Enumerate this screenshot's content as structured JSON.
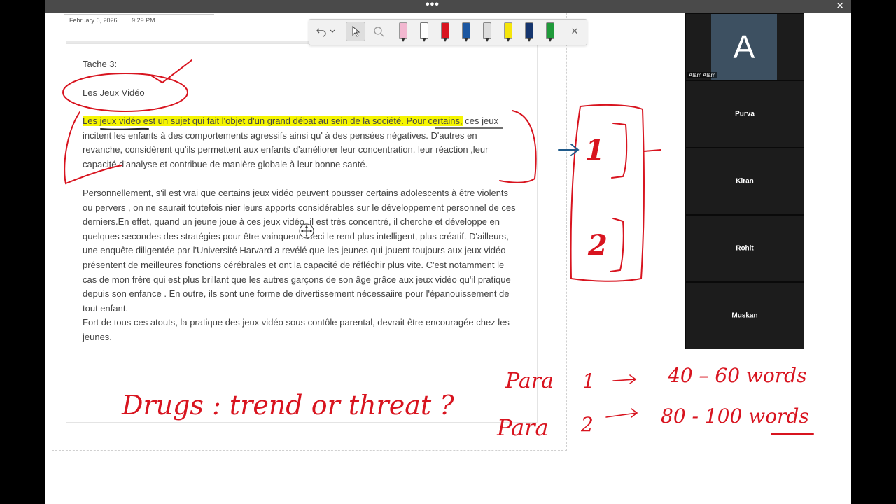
{
  "window": {
    "menu_dots": "•••",
    "close": "✕"
  },
  "note": {
    "date": "February 6, 2026",
    "time": "9:29 PM"
  },
  "toolbar": {
    "tools": [
      "undo-icon",
      "undo-dropdown-icon",
      "select-icon",
      "lasso-icon",
      "pink-highlighter-icon",
      "pen-white-icon",
      "red-pen-icon",
      "blue-pen-icon",
      "pencil-icon",
      "yellow-highlighter-icon",
      "navy-pen-icon",
      "green-pen-icon",
      "close-icon"
    ],
    "close": "✕"
  },
  "document": {
    "heading": "Tache 3:",
    "subtitle": "Les Jeux Vidéo",
    "p1_highlight_a": "Les jeux vidéo est un sujet qui fait l'objet d'un grand débat au sein de la société",
    "p1_highlight_b": ". Pour certains,",
    "p1_rest": "ces jeux  incitent les enfants à des comportements agressifs ainsi qu' à des pensées négatives. D'autres en revanche, considèrent qu'ils  permettent aux enfants d'améliorer leur concentration, leur réaction ,leur capacité d'analyse et contribue de manière globale à leur  bonne santé.",
    "p2": "Personnellement, s'il est vrai que certains jeux vidéo peuvent pousser certains adolescents à être violents ou pervers , on ne saurait toutefois nier leurs apports considérables sur le développement personnel de ces derniers.En effet, quand un jeune joue à ces jeux vidéo, il est très concentré, il cherche et développe en quelques secondes des stratégies pour être vainqueur. Ceci le rend plus intelligent, plus créatif. D'ailleurs, une enquête diligentée par l'Université Harvard a revélé que les jeunes qui jouent toujours aux jeux vidéo présentent de meilleures fonctions cérébrales et ont la capacité de réfléchir plus vite. C'est notamment le cas de mon frère qui est plus brillant que les autres garçons de son âge grâce aux jeux vidéo qu'il pratique depuis son enfance . En outre, ils sont une forme de divertissement nécessaiire pour l'épanouissement de tout enfant.",
    "p3": "Fort de tous ces atouts, la pratique des jeux vidéo sous contôle parental, devrait être encouragée chez les jeunes."
  },
  "ink": {
    "title": "Drugs : trend or threat ?",
    "box1": "1",
    "box2": "2",
    "row1_label": "Para",
    "row1_num": "1",
    "row1_range": "40 – 60 words",
    "row2_label": "Para",
    "row2_num": "2",
    "row2_range": "80 - 100 words",
    "color": "#d8141f",
    "arrow_color": "#1f5a8a"
  },
  "participants": [
    {
      "name": "Alam Alam",
      "initial": "A"
    },
    {
      "name": "Purva"
    },
    {
      "name": "Kiran"
    },
    {
      "name": "Rohit"
    },
    {
      "name": "Muskan"
    }
  ]
}
